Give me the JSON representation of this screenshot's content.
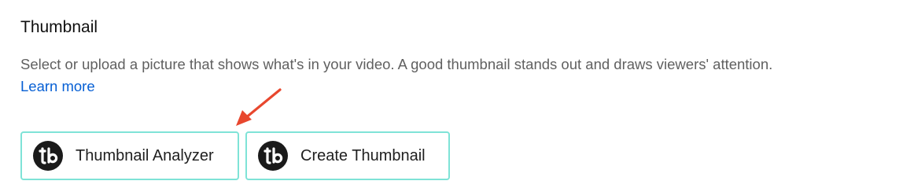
{
  "section": {
    "title": "Thumbnail",
    "description": "Select or upload a picture that shows what's in your video. A good thumbnail stands out and draws viewers' attention.",
    "learn_more": "Learn more"
  },
  "buttons": {
    "analyzer": {
      "label": "Thumbnail Analyzer",
      "icon": "tubebuddy-logo-icon"
    },
    "create": {
      "label": "Create Thumbnail",
      "icon": "tubebuddy-logo-icon"
    }
  },
  "annotation": {
    "arrow_color": "#e8472e",
    "points_to": "Thumbnail Analyzer"
  },
  "colors": {
    "button_border": "#7fe3d7",
    "link": "#065fd4",
    "logo_bg": "#1a1a1a"
  }
}
